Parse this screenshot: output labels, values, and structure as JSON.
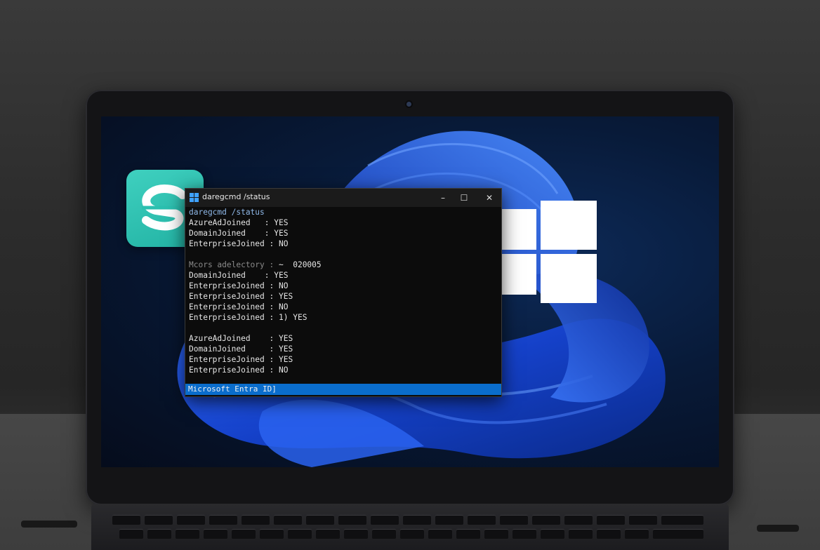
{
  "window": {
    "title": "daregcmd /status",
    "controls": {
      "minimize": "–",
      "maximize": "☐",
      "close": "✕"
    }
  },
  "console": {
    "command": "daregcmd /status",
    "rows": [
      {
        "key": "AzureAdJoined",
        "sep": "   :",
        "value": "YES"
      },
      {
        "key": "DomainJoined",
        "sep": "    :",
        "value": "YES"
      },
      {
        "key": "EnterpriseJoined",
        "sep": " :",
        "value": "NO"
      },
      {
        "key": "Mcors adelectory",
        "sep": " :",
        "value": "~  020005"
      },
      {
        "key": "DomainJoined",
        "sep": "    :",
        "value": "YES"
      },
      {
        "key": "EnterpriseJoined",
        "sep": " :",
        "value": "NO"
      },
      {
        "key": "EnterpriseJoined",
        "sep": " :",
        "value": "YES"
      },
      {
        "key": "EnterpriseJoined",
        "sep": " :",
        "value": "NO"
      },
      {
        "key": "EnterpriseJoined",
        "sep": " :",
        "value": "1) YES"
      },
      {
        "key": "AzureAdJoined",
        "sep": "    :",
        "value": "YES"
      },
      {
        "key": "DomainJoined",
        "sep": "     :",
        "value": "YES"
      },
      {
        "key": "EnterpriseJoined",
        "sep": " :",
        "value": "YES"
      },
      {
        "key": "EnterpriseJoined",
        "sep": " :",
        "value": "NO"
      }
    ]
  },
  "statusbar": {
    "text": "Microsoft Entra ID]"
  },
  "colors": {
    "terminal_bg": "#0c0c0c",
    "statusbar": "#0a6dcc",
    "app_tile": "#2bc0b0",
    "accent_blue": "#1f5bdc"
  },
  "icons": {
    "app": "s-logo-icon",
    "os": "windows-logo-icon",
    "terminal": "terminal-icon"
  }
}
